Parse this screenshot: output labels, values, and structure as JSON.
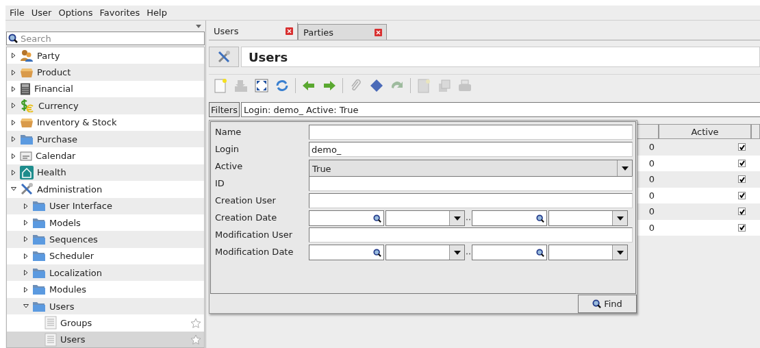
{
  "menu": [
    "File",
    "User",
    "Options",
    "Favorites",
    "Help"
  ],
  "sidebar": {
    "search": {
      "placeholder": "Search"
    },
    "items": [
      {
        "label": "Party",
        "kind": "party",
        "expanded": false,
        "selected": false
      },
      {
        "label": "Product",
        "kind": "box",
        "expanded": false,
        "selected": false
      },
      {
        "label": "Financial",
        "kind": "calculator",
        "expanded": false,
        "selected": false
      },
      {
        "label": "Currency",
        "kind": "currency",
        "expanded": false,
        "selected": false
      },
      {
        "label": "Inventory & Stock",
        "kind": "box",
        "expanded": false,
        "selected": false
      },
      {
        "label": "Purchase",
        "kind": "folder",
        "expanded": false,
        "selected": false
      },
      {
        "label": "Calendar",
        "kind": "calendar",
        "expanded": false,
        "selected": false
      },
      {
        "label": "Health",
        "kind": "health",
        "expanded": false,
        "selected": false
      },
      {
        "label": "Administration",
        "kind": "tools",
        "expanded": true,
        "selected": false,
        "children": [
          {
            "label": "User Interface",
            "kind": "folder",
            "expanded": false,
            "selected": false
          },
          {
            "label": "Models",
            "kind": "folder",
            "expanded": false,
            "selected": false
          },
          {
            "label": "Sequences",
            "kind": "folder",
            "expanded": false,
            "selected": false
          },
          {
            "label": "Scheduler",
            "kind": "folder",
            "expanded": false,
            "selected": false
          },
          {
            "label": "Localization",
            "kind": "folder",
            "expanded": false,
            "selected": false
          },
          {
            "label": "Modules",
            "kind": "folder",
            "expanded": false,
            "selected": false
          },
          {
            "label": "Users",
            "kind": "folder",
            "expanded": true,
            "selected": false,
            "children": [
              {
                "label": "Groups",
                "kind": "form",
                "selected": false,
                "favorite": false
              },
              {
                "label": "Users",
                "kind": "form",
                "selected": true,
                "favorite": false
              }
            ]
          }
        ]
      }
    ]
  },
  "tabs": [
    {
      "label": "Users",
      "selected": true
    },
    {
      "label": "Parties",
      "selected": false
    }
  ],
  "form": {
    "title": "Users"
  },
  "toolbar": [
    {
      "kind": "new",
      "disabled": false
    },
    {
      "kind": "save",
      "disabled": true
    },
    {
      "kind": "switch",
      "disabled": false
    },
    {
      "kind": "reload",
      "disabled": false
    },
    {
      "kind": "separator"
    },
    {
      "kind": "previous",
      "disabled": false
    },
    {
      "kind": "next",
      "disabled": false
    },
    {
      "kind": "separator"
    },
    {
      "kind": "attach",
      "disabled": true
    },
    {
      "kind": "action",
      "disabled": false
    },
    {
      "kind": "relate",
      "disabled": true
    },
    {
      "kind": "separator"
    },
    {
      "kind": "report",
      "disabled": true
    },
    {
      "kind": "email",
      "disabled": true
    },
    {
      "kind": "print",
      "disabled": true
    }
  ],
  "filter": {
    "button": "Filters",
    "value": "Login: demo_ Active: True",
    "find": "Find",
    "fields": [
      {
        "label": "Name",
        "kind": "text"
      },
      {
        "label": "Login",
        "kind": "text",
        "value": "demo_"
      },
      {
        "label": "Active",
        "kind": "select",
        "value": "True"
      },
      {
        "label": "ID",
        "kind": "text"
      },
      {
        "label": "Creation User",
        "kind": "text"
      },
      {
        "label": "Creation Date",
        "kind": "daterange"
      },
      {
        "label": "Modification User",
        "kind": "text"
      },
      {
        "label": "Modification Date",
        "kind": "daterange"
      }
    ]
  },
  "table": {
    "columns": [
      "Active"
    ],
    "rows": [
      {
        "cell": "0",
        "active": true
      },
      {
        "cell": "0",
        "active": true
      },
      {
        "cell": "0",
        "active": true
      },
      {
        "cell": "0",
        "active": true
      },
      {
        "cell": "0",
        "active": true
      },
      {
        "cell": "0",
        "active": true
      }
    ]
  }
}
